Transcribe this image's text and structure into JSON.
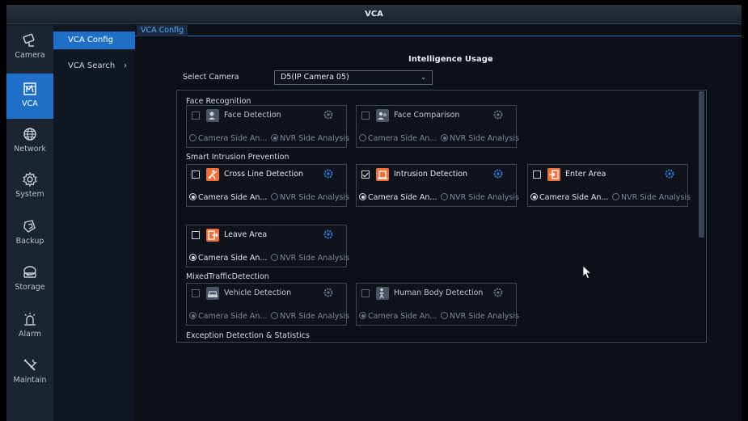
{
  "window": {
    "title": "VCA"
  },
  "colors": {
    "accent": "#1f6fc9",
    "feature_orange": "#f1703a",
    "gear_blue": "#2f7de0"
  },
  "nav": {
    "items": [
      {
        "label": "Camera",
        "icon": "camera-icon"
      },
      {
        "label": "VCA",
        "icon": "vca-icon",
        "active": true
      },
      {
        "label": "Network",
        "icon": "network-icon"
      },
      {
        "label": "System",
        "icon": "system-gear-icon"
      },
      {
        "label": "Backup",
        "icon": "backup-icon"
      },
      {
        "label": "Storage",
        "icon": "storage-icon"
      },
      {
        "label": "Alarm",
        "icon": "alarm-icon"
      },
      {
        "label": "Maintain",
        "icon": "maintain-icon"
      }
    ]
  },
  "submenu": {
    "items": [
      {
        "label": "VCA Config",
        "active": true
      },
      {
        "label": "VCA Search",
        "chevron": "›"
      }
    ]
  },
  "tabs": {
    "active": "VCA Config"
  },
  "intelligence": {
    "label": "Intelligence Usage",
    "chevron": "⌄"
  },
  "select_camera": {
    "label": "Select Camera",
    "value": "D5(IP Camera 05)",
    "arrow": "⌄"
  },
  "groups": {
    "face": "Face Recognition",
    "smart": "Smart Intrusion Prevention",
    "mixed": "MixedTrafficDetection",
    "exception": "Exception Detection & Statistics"
  },
  "features": [
    {
      "name": "Face Detection",
      "icon": "face-detection-icon",
      "checked": false,
      "enabled": false,
      "camera_side": "Camera Side An...",
      "nvr_side": "NVR Side Analysis",
      "selected": "nvr"
    },
    {
      "name": "Face Comparison",
      "icon": "face-comparison-icon",
      "checked": false,
      "enabled": false,
      "camera_side": "Camera Side An...",
      "nvr_side": "NVR Side Analysis",
      "selected": "nvr"
    },
    {
      "name": "Cross Line Detection",
      "icon": "cross-line-icon",
      "checked": false,
      "enabled": true,
      "camera_side": "Camera Side An...",
      "nvr_side": "NVR Side Analysis",
      "selected": "camera"
    },
    {
      "name": "Intrusion Detection",
      "icon": "intrusion-icon",
      "checked": true,
      "enabled": true,
      "camera_side": "Camera Side An...",
      "nvr_side": "NVR Side Analysis",
      "selected": "camera"
    },
    {
      "name": "Enter Area",
      "icon": "enter-area-icon",
      "checked": false,
      "enabled": true,
      "camera_side": "Camera Side An...",
      "nvr_side": "NVR Side Analysis",
      "selected": "camera"
    },
    {
      "name": "Leave Area",
      "icon": "leave-area-icon",
      "checked": false,
      "enabled": true,
      "camera_side": "Camera Side An...",
      "nvr_side": "NVR Side Analysis",
      "selected": "camera"
    },
    {
      "name": "Vehicle Detection",
      "icon": "vehicle-detection-icon",
      "checked": false,
      "enabled": false,
      "camera_side": "Camera Side An...",
      "nvr_side": "NVR Side Analysis",
      "selected": "camera"
    },
    {
      "name": "Human Body Detection",
      "icon": "human-body-icon",
      "checked": false,
      "enabled": false,
      "camera_side": "Camera Side An...",
      "nvr_side": "NVR Side Analysis",
      "selected": "camera"
    }
  ]
}
